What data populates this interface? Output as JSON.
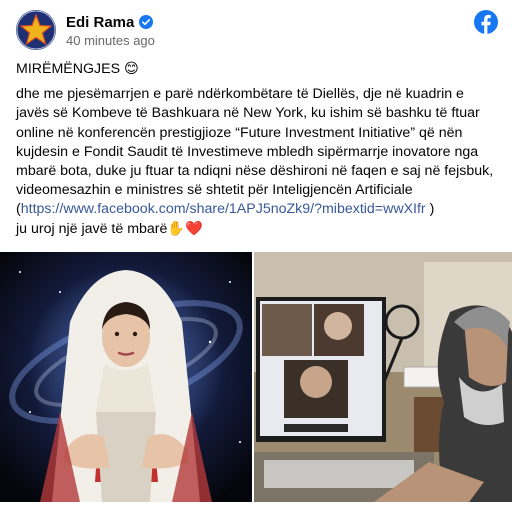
{
  "post": {
    "author": "Edi Rama",
    "timestamp": "40 minutes ago",
    "greeting": "MIRËMËNGJES 😊",
    "body_before_link": "dhe me pjesëmarrjen e parë ndërkombëtare të Diellës, dje në kuadrin e javës së Kombeve të Bashkuara në New York, ku ishim së bashku të ftuar online në konferencën prestigjioze “Future Investment Initiative” që nën kujdesin e Fondit Saudit të Investimeve mbledh sipërmarrje inovatore nga mbarë bota, duke ju ftuar ta ndiqni nëse dëshironi në faqen e saj në fejsbuk, videomesazhin e ministres së shtetit për Inteligjencën Artificiale (",
    "link": "https://www.facebook.com/share/1APJ5noZk9/?mibextid=wwXIfr",
    "body_after_link": " )",
    "closing": "ju uroj një javë të mbarë✋",
    "closing_heart": "❤️"
  },
  "icons": {
    "avatar": "star-flag-avatar",
    "verified": "verified-badge-icon",
    "platform": "facebook-icon"
  },
  "colors": {
    "link": "#385898",
    "facebook_blue": "#1877f2",
    "secondary_text": "#65676b"
  }
}
